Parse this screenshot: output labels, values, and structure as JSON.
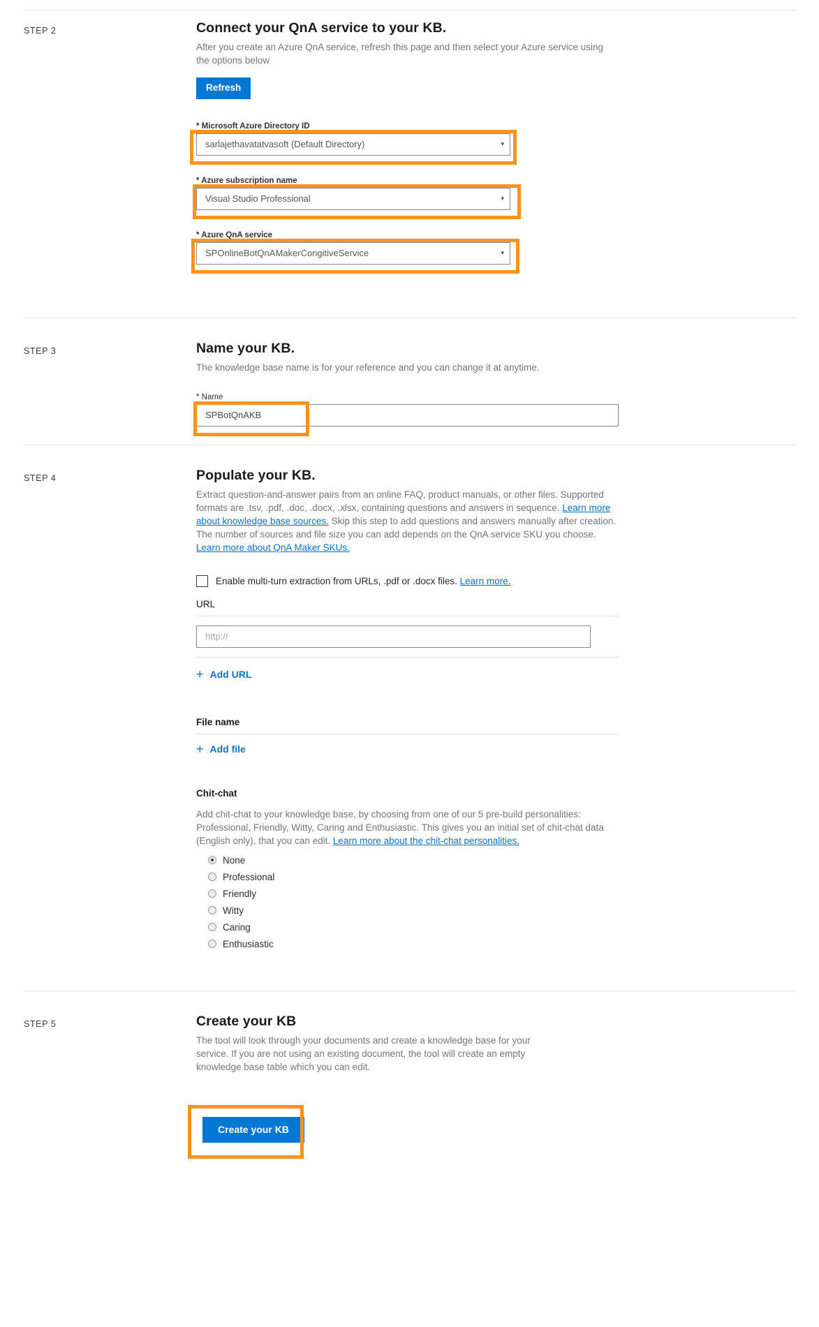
{
  "steps": {
    "step2": {
      "label": "STEP 2",
      "title": "Connect your QnA service to your KB.",
      "desc": "After you create an Azure QnA service, refresh this page and then select your Azure service using the options below",
      "refresh_label": "Refresh",
      "fields": [
        {
          "label": "* Microsoft Azure Directory ID",
          "value": "sarlajethavatatvasoft (Default Directory)",
          "icon": "chevron-down-icon"
        },
        {
          "label": "* Azure subscription name",
          "value": "Visual Studio Professional",
          "icon": "chevron-down-icon"
        },
        {
          "label": "* Azure QnA service",
          "value": "SPOnlineBotQnAMakerCongitiveService",
          "icon": "chevron-down-icon"
        }
      ]
    },
    "step3": {
      "label": "STEP 3",
      "title": "Name your KB.",
      "desc": "The knowledge base name is for your reference and you can change it at anytime.",
      "name_label": "* Name",
      "name_value": "SPBotQnAKB"
    },
    "step4": {
      "label": "STEP 4",
      "title": "Populate your KB.",
      "desc_part1": "Extract question-and-answer pairs from an online FAQ, product manuals, or other files. Supported formats are .tsv, .pdf, .doc, .docx, .xlsx, containing questions and answers in sequence. ",
      "link1": "Learn more about knowledge base sources.",
      "desc_part2": " Skip this step to add questions and answers manually after creation. The number of sources and file size you can add depends on the QnA service SKU you choose. ",
      "link2": "Learn more about QnA Maker SKUs.",
      "multiturn_label": "Enable multi-turn extraction from URLs, .pdf or .docx files.",
      "multiturn_link": "Learn more.",
      "url_header": "URL",
      "url_placeholder": "http://",
      "url_value": "",
      "add_url_label": "Add URL",
      "file_header": "File name",
      "add_file_label": "Add file",
      "chitchat_title": "Chit-chat",
      "chitchat_desc_part1": "Add chit-chat to your knowledge base, by choosing from one of our 5 pre-build personalities: Professional, Friendly, Witty, Caring and Enthusiastic. This gives you an initial set of chit-chat data (English only), that you can edit. ",
      "chitchat_link": "Learn more about the chit-chat personalities.",
      "personalities": [
        {
          "label": "None",
          "selected": true
        },
        {
          "label": "Professional",
          "selected": false
        },
        {
          "label": "Friendly",
          "selected": false
        },
        {
          "label": "Witty",
          "selected": false
        },
        {
          "label": "Caring",
          "selected": false
        },
        {
          "label": "Enthusiastic",
          "selected": false
        }
      ]
    },
    "step5": {
      "label": "STEP 5",
      "title": "Create your KB",
      "desc": "The tool will look through your documents and create a knowledge base for your service. If you are not using an existing document, the tool will create an empty knowledge base table which you can edit.",
      "create_label": "Create your KB"
    }
  },
  "icons": {
    "chevron": "▾",
    "plus": "+"
  },
  "colors": {
    "accent": "#0078d4",
    "link": "#0b72c4",
    "highlight": "#f7941e"
  }
}
